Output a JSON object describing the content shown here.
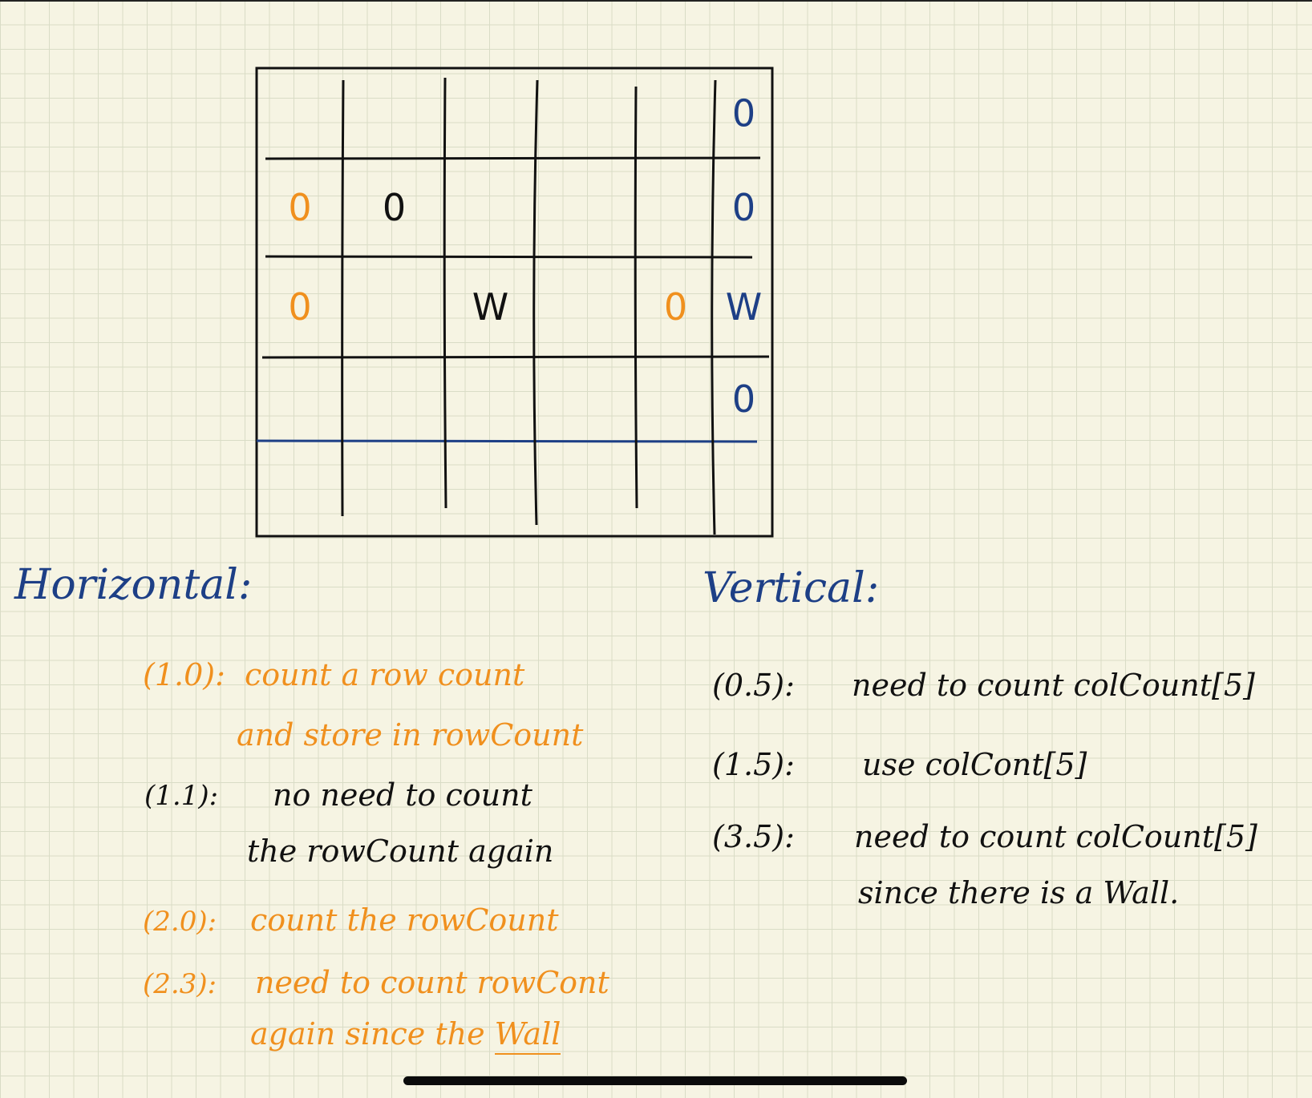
{
  "board": {
    "rows": 5,
    "cols": 6,
    "marks": [
      {
        "row": 0,
        "col": 5,
        "text": "0",
        "color": "#1d3f86"
      },
      {
        "row": 1,
        "col": 0,
        "text": "0",
        "color": "#f0901e"
      },
      {
        "row": 1,
        "col": 1,
        "text": "0",
        "color": "#111111"
      },
      {
        "row": 1,
        "col": 5,
        "text": "0",
        "color": "#1d3f86"
      },
      {
        "row": 2,
        "col": 0,
        "text": "0",
        "color": "#f0901e"
      },
      {
        "row": 2,
        "col": 2,
        "text": "W",
        "color": "#111111"
      },
      {
        "row": 2,
        "col": 4,
        "text": "0",
        "color": "#f0901e"
      },
      {
        "row": 2,
        "col": 5,
        "text": "W",
        "color": "#1d3f86"
      },
      {
        "row": 3,
        "col": 5,
        "text": "0",
        "color": "#1d3f86"
      }
    ]
  },
  "horizontal": {
    "heading": "Horizontal:",
    "notes": [
      {
        "label": "(1.0):",
        "lines": [
          "count a row count",
          "and store in rowCount"
        ],
        "color": "#f0901e"
      },
      {
        "label": "(1.1):",
        "lines": [
          "no need to count",
          "the rowCount again"
        ],
        "color": "#111111"
      },
      {
        "label": "(2.0):",
        "lines": [
          "count the rowCount"
        ],
        "color": "#f0901e"
      },
      {
        "label": "(2.3):",
        "lines": [
          "need to count rowCont",
          "again since the"
        ],
        "underlined": "Wall",
        "color": "#f0901e"
      }
    ]
  },
  "vertical": {
    "heading": "Vertical:",
    "notes": [
      {
        "label": "(0.5):",
        "lines": [
          "need to count colCount[5]"
        ]
      },
      {
        "label": "(1.5):",
        "lines": [
          "use colCont[5]"
        ]
      },
      {
        "label": "(3.5):",
        "lines": [
          "need to count colCount[5]",
          "since there is a Wall."
        ]
      }
    ]
  },
  "colors": {
    "ink_black": "#111111",
    "ink_blue": "#1d3f86",
    "ink_orange": "#f0901e",
    "paper": "#f6f4e3"
  }
}
